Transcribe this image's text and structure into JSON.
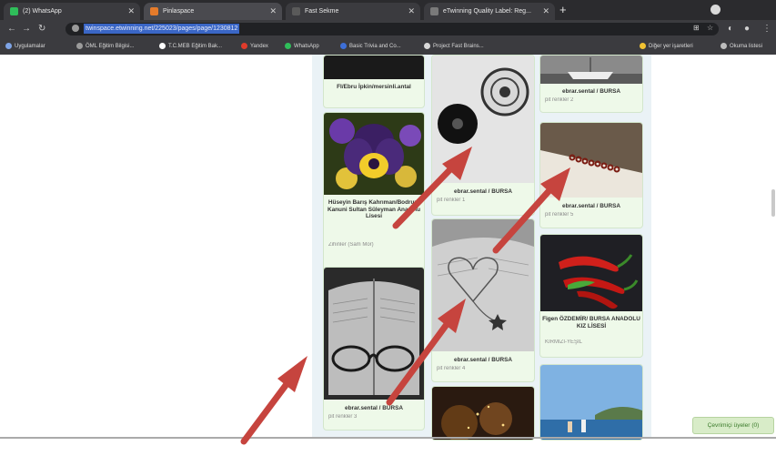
{
  "tabs": [
    {
      "title": "(2) WhatsApp",
      "favicon_color": "#2fbe5a",
      "active": false
    },
    {
      "title": "Pinlaspace",
      "favicon_color": "#e57b2b",
      "active": true
    },
    {
      "title": "Fast Sekme",
      "favicon_color": "#5a5a5a",
      "active": false
    },
    {
      "title": "eTwinning Quality Label: Reg...",
      "favicon_color": "#7a7a7a",
      "active": false
    }
  ],
  "address_bar": {
    "url": "twinspace.etwinning.net/225023/pages/page/1230812"
  },
  "bookmarks": [
    {
      "label": "Uygulamalar",
      "color": "#7ea4e6"
    },
    {
      "label": "ÖML Eğitim Bilgisi...",
      "color": "#9b9b9b"
    },
    {
      "label": "T.C.MEB Eğitim Bak...",
      "color": "#ffffff"
    },
    {
      "label": "Yandex",
      "color": "#e03b2b"
    },
    {
      "label": "WhatsApp",
      "color": "#2fbe5a"
    },
    {
      "label": "Basic Trivia and Co...",
      "color": "#3d6fd8"
    },
    {
      "label": "Project Fast Brains...",
      "color": "#d8d8d8"
    },
    {
      "label": "Diğer yer işaretleri",
      "color": "#f1c232"
    },
    {
      "label": "Okuma listesi",
      "color": "#bdbdbd"
    }
  ],
  "gallery": {
    "cards": [
      {
        "title": "FI/Ebru İpkin/mersinli.antal",
        "subtitle": ""
      },
      {
        "title": "Hüseyin Barış Kahrıman/Bodrum Kanuni Sultan Süleyman Anadolu Lisesi",
        "subtitle": "Zihinler (Sam Mor)"
      },
      {
        "title": "ebrar.sental / BURSA",
        "subtitle": "pit renkler 3"
      },
      {
        "title": "ebrar.sental / BURSA",
        "subtitle": "pit renkler 1"
      },
      {
        "title": "ebrar.sental / BURSA",
        "subtitle": "pit renkler 4"
      },
      {
        "title": "ebrar.sental / BURSA",
        "subtitle": "pit renkler 2"
      },
      {
        "title": "ebrar.sental / BURSA",
        "subtitle": "pit renkler 5"
      },
      {
        "title": "Figen ÖZDEMİR/ BURSA ANADOLU KIZ LİSESİ",
        "subtitle": "KIRMIZI-YEŞİL"
      }
    ]
  },
  "follow_button": {
    "label": "Çevrimiçi üyeler (0)"
  },
  "colors": {
    "arrow": "#c6443e",
    "card_bg": "#eef9e9",
    "column_bg": "#eaf2f6"
  }
}
